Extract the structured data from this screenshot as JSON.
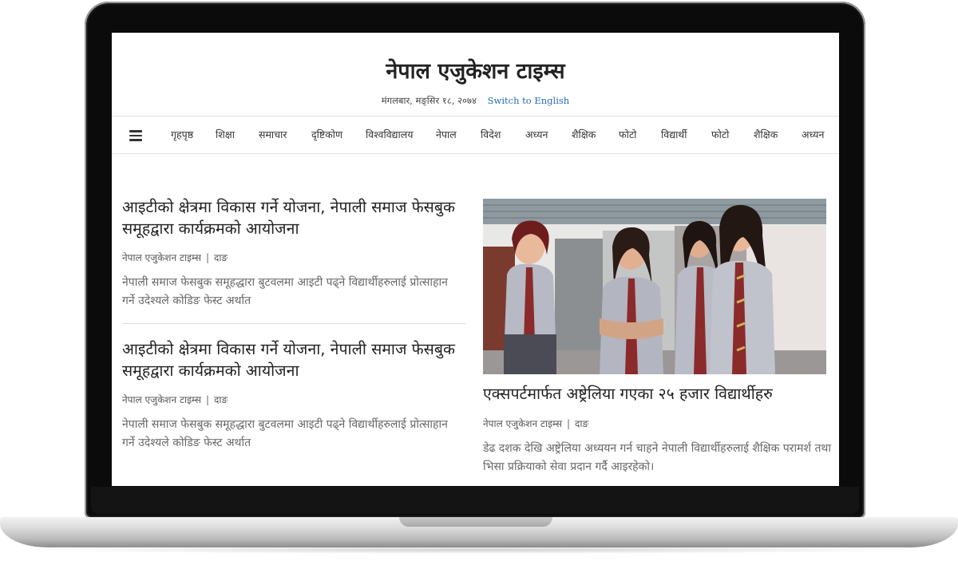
{
  "site": {
    "title": "नेपाल एजुकेशन टाइम्स",
    "date": "मंगलबार, मङ्सिर १८, २०७४",
    "switch_language": "Switch to English"
  },
  "nav": {
    "menu_icon": "hamburger-icon",
    "items": [
      "गृहपृष्ठ",
      "शिक्षा",
      "समाचार",
      "दृष्टिकोण",
      "विश्वविद्यालय",
      "नेपाल",
      "विदेश",
      "अध्यन",
      "शैक्षिक",
      "फोटो",
      "विद्यार्थी",
      "फोटो",
      "शैक्षिक",
      "अध्यन"
    ]
  },
  "articles_left": [
    {
      "title": "आइटीको क्षेत्रमा विकास गर्ने योजना, नेपाली समाज फेसबुक समूहद्वारा कार्यक्रमको आयोजना",
      "source": "नेपाल एजुकेशन टाइम्स",
      "category": "दाङ",
      "summary": "नेपाली समाज फेसबुक समूहद्धारा बुटवलमा आइटी पढ्ने विद्यार्थीहरुलाई प्रोत्साहान गर्ने उदेश्यले कोडिङ फेस्ट अर्थात"
    },
    {
      "title": "आइटीको क्षेत्रमा विकास गर्ने योजना, नेपाली समाज फेसबुक समूहद्वारा कार्यक्रमको आयोजना",
      "source": "नेपाल एजुकेशन टाइम्स",
      "category": "दाङ",
      "summary": "नेपाली समाज फेसबुक समूहद्धारा बुटवलमा आइटी पढ्ने विद्यार्थीहरुलाई प्रोत्साहान गर्ने उदेश्यले कोडिङ फेस्ट अर्थात"
    }
  ],
  "featured": {
    "image": "students-in-uniform-photo",
    "title": "एक्सपर्टमार्फत अष्ट्रेलिया गएका २५ हजार विद्यार्थीहरु",
    "source": "नेपाल एजुकेशन टाइम्स",
    "category": "दाङ",
    "summary": "डेढ दशक देखि अष्ट्रेलिया अध्ययन गर्न चाहने नेपाली विद्यार्थीहरुलाई शैक्षिक परामर्श तथा भिसा प्रक्रियाको सेवा प्रदान गर्दै आइरहेको।"
  },
  "colors": {
    "link": "#2b6cb0",
    "text": "#222222",
    "muted": "#666666",
    "laptop_bezel": "#0b0b0b"
  }
}
